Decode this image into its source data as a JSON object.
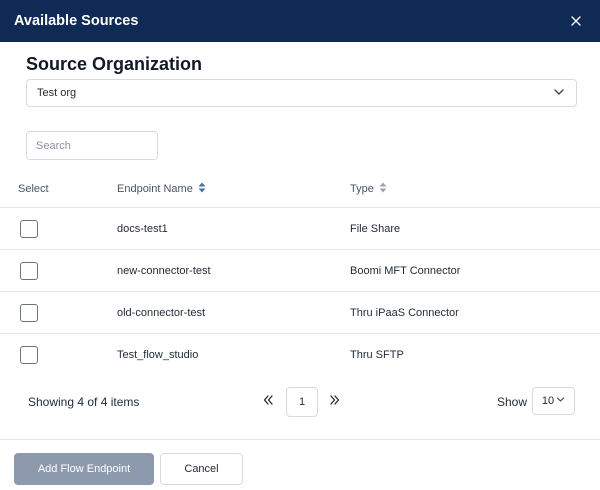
{
  "modal": {
    "title": "Available Sources",
    "close_icon": "close-icon"
  },
  "source_org": {
    "heading": "Source Organization",
    "selected": "Test org"
  },
  "search": {
    "placeholder": "Search",
    "value": ""
  },
  "table": {
    "headers": {
      "select": "Select",
      "name": "Endpoint Name",
      "type": "Type"
    },
    "sort_active_color": "#4a6fa5",
    "rows": [
      {
        "name": "docs-test1",
        "type": "File Share",
        "checked": false
      },
      {
        "name": "new-connector-test",
        "type": "Boomi MFT Connector",
        "checked": false
      },
      {
        "name": "old-connector-test",
        "type": "Thru iPaaS Connector",
        "checked": false
      },
      {
        "name": "Test_flow_studio",
        "type": "Thru SFTP",
        "checked": false
      }
    ]
  },
  "pagination": {
    "summary": "Showing 4 of 4 items",
    "page": "1",
    "show_label": "Show",
    "page_size": "10"
  },
  "footer": {
    "primary_label": "Add Flow Endpoint",
    "cancel_label": "Cancel"
  },
  "colors": {
    "header_bg": "#0f2a55",
    "primary_disabled": "#8d9aad"
  }
}
